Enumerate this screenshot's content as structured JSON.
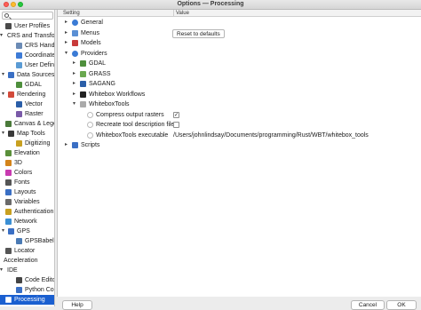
{
  "window": {
    "title": "Options — Processing"
  },
  "sidebar": {
    "items": [
      {
        "label": "User Profiles",
        "icon": "user-icon",
        "color": "#4a4a4a",
        "indent": 1,
        "arrow": ""
      },
      {
        "label": "CRS and Transform",
        "icon": "",
        "color": "",
        "indent": 0,
        "arrow": "▾"
      },
      {
        "label": "CRS Handling",
        "icon": "crs-icon",
        "color": "#6b8bb5",
        "indent": 2,
        "arrow": ""
      },
      {
        "label": "Coordinate",
        "icon": "coordinate-icon",
        "color": "#3d7bd6",
        "indent": 2,
        "arrow": ""
      },
      {
        "label": "User Defined",
        "icon": "user-defined-icon",
        "color": "#5a9bd4",
        "indent": 2,
        "arrow": ""
      },
      {
        "label": "Data Sources",
        "icon": "data-sources-icon",
        "color": "#3a6fc4",
        "indent": 1,
        "arrow": "▾"
      },
      {
        "label": "GDAL",
        "icon": "gdal-icon",
        "color": "#4e8f3c",
        "indent": 2,
        "arrow": ""
      },
      {
        "label": "Rendering",
        "icon": "rendering-icon",
        "color": "#d24a3a",
        "indent": 1,
        "arrow": "▾"
      },
      {
        "label": "Vector",
        "icon": "vector-icon",
        "color": "#2a5ea8",
        "indent": 2,
        "arrow": ""
      },
      {
        "label": "Raster",
        "icon": "raster-icon",
        "color": "#7a5aa8",
        "indent": 2,
        "arrow": ""
      },
      {
        "label": "Canvas & Legend",
        "icon": "canvas-icon",
        "color": "#4a7a3a",
        "indent": 1,
        "arrow": ""
      },
      {
        "label": "Map Tools",
        "icon": "map-tools-icon",
        "color": "#3a3a3a",
        "indent": 1,
        "arrow": "▾"
      },
      {
        "label": "Digitizing",
        "icon": "digitizing-icon",
        "color": "#c8a020",
        "indent": 2,
        "arrow": ""
      },
      {
        "label": "Elevation",
        "icon": "elevation-icon",
        "color": "#5a8f3a",
        "indent": 1,
        "arrow": ""
      },
      {
        "label": "3D",
        "icon": "3d-icon",
        "color": "#d4841a",
        "indent": 1,
        "arrow": ""
      },
      {
        "label": "Colors",
        "icon": "colors-icon",
        "color": "#c83ab0",
        "indent": 1,
        "arrow": ""
      },
      {
        "label": "Fonts",
        "icon": "fonts-icon",
        "color": "#555555",
        "indent": 1,
        "arrow": ""
      },
      {
        "label": "Layouts",
        "icon": "layouts-icon",
        "color": "#3a6fc4",
        "indent": 1,
        "arrow": ""
      },
      {
        "label": "Variables",
        "icon": "variables-icon",
        "color": "#6a6a6a",
        "indent": 1,
        "arrow": ""
      },
      {
        "label": "Authentication",
        "icon": "authentication-icon",
        "color": "#c8a020",
        "indent": 1,
        "arrow": ""
      },
      {
        "label": "Network",
        "icon": "network-icon",
        "color": "#3a8fd4",
        "indent": 1,
        "arrow": ""
      },
      {
        "label": "GPS",
        "icon": "gps-icon",
        "color": "#3a6fc4",
        "indent": 1,
        "arrow": "▾"
      },
      {
        "label": "GPSBabel",
        "icon": "gpsbabel-icon",
        "color": "#4a7ab4",
        "indent": 2,
        "arrow": ""
      },
      {
        "label": "Locator",
        "icon": "locator-icon",
        "color": "#555555",
        "indent": 1,
        "arrow": ""
      },
      {
        "label": "Acceleration",
        "icon": "",
        "color": "",
        "indent": 1,
        "arrow": ""
      },
      {
        "label": "IDE",
        "icon": "",
        "color": "",
        "indent": 0,
        "arrow": "▾"
      },
      {
        "label": "Code Editor",
        "icon": "code-editor-icon",
        "color": "#444444",
        "indent": 2,
        "arrow": ""
      },
      {
        "label": "Python Console",
        "icon": "python-icon",
        "color": "#3a6fc4",
        "indent": 2,
        "arrow": ""
      },
      {
        "label": "Processing",
        "icon": "processing-icon",
        "color": "#ffffff",
        "indent": 1,
        "arrow": "",
        "selected": true
      }
    ]
  },
  "table": {
    "header_setting": "Setting",
    "header_value": "Value",
    "rows": [
      {
        "label": "General",
        "level": 0,
        "arrow": "▸",
        "icon": "gear-icon",
        "color": "#3a7bd5",
        "value": "",
        "type": "text"
      },
      {
        "label": "Menus",
        "level": 0,
        "arrow": "▸",
        "icon": "menus-icon",
        "color": "#5a8fd4",
        "value": "Reset to defaults",
        "type": "button"
      },
      {
        "label": "Models",
        "level": 0,
        "arrow": "▸",
        "icon": "models-icon",
        "color": "#c83a3a",
        "value": "",
        "type": "text"
      },
      {
        "label": "Providers",
        "level": 0,
        "arrow": "▾",
        "icon": "providers-icon",
        "color": "#3a7bd5",
        "value": "",
        "type": "text"
      },
      {
        "label": "GDAL",
        "level": 1,
        "arrow": "▸",
        "icon": "gdal-icon",
        "color": "#4e8f3c",
        "value": "",
        "type": "text"
      },
      {
        "label": "GRASS",
        "level": 1,
        "arrow": "▸",
        "icon": "grass-icon",
        "color": "#6aa84f",
        "value": "",
        "type": "text"
      },
      {
        "label": "SAGANG",
        "level": 1,
        "arrow": "▸",
        "icon": "saga-icon",
        "color": "#2a5ea8",
        "value": "",
        "type": "text"
      },
      {
        "label": "Whitebox Workflows",
        "level": 1,
        "arrow": "▸",
        "icon": "whitebox-workflows-icon",
        "color": "#222222",
        "value": "",
        "type": "text"
      },
      {
        "label": "WhiteboxTools",
        "level": 1,
        "arrow": "▾",
        "icon": "whiteboxtools-icon",
        "color": "#aaaaaa",
        "value": "",
        "type": "text"
      },
      {
        "label": "Compress output rasters",
        "level": 2,
        "arrow": "",
        "icon": "option-icon",
        "color": "#bbbbbb",
        "value": "✓",
        "type": "checkbox"
      },
      {
        "label": "Recreate tool description files",
        "level": 2,
        "arrow": "",
        "icon": "option-icon",
        "color": "#bbbbbb",
        "value": "",
        "type": "checkbox"
      },
      {
        "label": "WhiteboxTools executable",
        "level": 2,
        "arrow": "",
        "icon": "option-icon",
        "color": "#bbbbbb",
        "value": "/Users/johnlindsay/Documents/programming/Rust/WBT/whitebox_tools",
        "type": "text"
      },
      {
        "label": "Scripts",
        "level": 0,
        "arrow": "▸",
        "icon": "scripts-icon",
        "color": "#3a6fc4",
        "value": "",
        "type": "text"
      }
    ]
  },
  "footer": {
    "help": "Help",
    "cancel": "Cancel",
    "ok": "OK"
  },
  "colors": {
    "accent": "#1a5fd0"
  }
}
